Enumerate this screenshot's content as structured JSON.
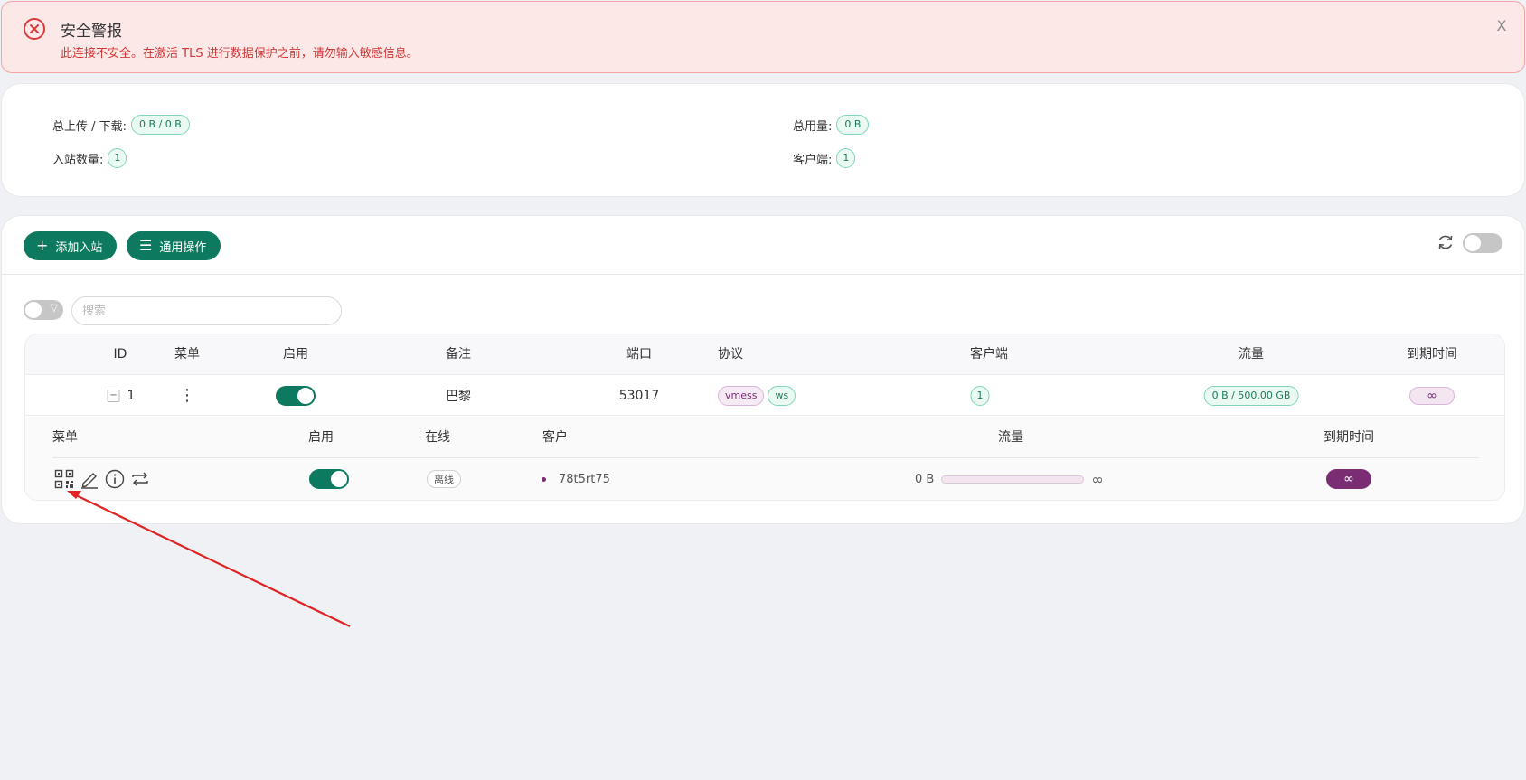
{
  "alert": {
    "title": "安全警报",
    "message": "此连接不安全。在激活 TLS 进行数据保护之前，请勿输入敏感信息。",
    "close": "X"
  },
  "stats": {
    "total_updown_label": "总上传 / 下载:",
    "total_updown_value": "0 B / 0 B",
    "total_usage_label": "总用量:",
    "total_usage_value": "0 B",
    "inbound_count_label": "入站数量:",
    "inbound_count_value": "1",
    "clients_label": "客户端:",
    "clients_value": "1"
  },
  "toolbar": {
    "add_inbound": "添加入站",
    "general_actions": "通用操作"
  },
  "search": {
    "placeholder": "搜索"
  },
  "table": {
    "headers": {
      "id": "ID",
      "menu": "菜单",
      "enable": "启用",
      "remark": "备注",
      "port": "端口",
      "protocol": "协议",
      "clients": "客户端",
      "traffic": "流量",
      "expiry": "到期时间"
    },
    "row": {
      "id": "1",
      "menu": "⋮",
      "remark": "巴黎",
      "port": "53017",
      "protocol": "vmess",
      "transport": "ws",
      "clients": "1",
      "traffic": "0 B / 500.00 GB",
      "expiry": "∞"
    }
  },
  "clients_table": {
    "headers": {
      "menu": "菜单",
      "enable": "启用",
      "online": "在线",
      "client": "客户",
      "traffic": "流量",
      "expiry": "到期时间"
    },
    "row": {
      "status": "离线",
      "name": "78t5rt75",
      "traffic_used": "0 B",
      "traffic_used_fraction": 0,
      "traffic_total": "∞",
      "expiry": "∞"
    }
  },
  "colors": {
    "accent": "#0d7a60",
    "purple": "#7b2d74",
    "alert_red": "#d03838",
    "annotation_arrow": "#e02424"
  },
  "icons": [
    "error-circle-icon",
    "close-icon",
    "plus-icon",
    "menu-lines-icon",
    "refresh-icon",
    "filter-icon",
    "qrcode-icon",
    "edit-icon",
    "info-icon",
    "reset-icon",
    "more-vertical-icon"
  ]
}
